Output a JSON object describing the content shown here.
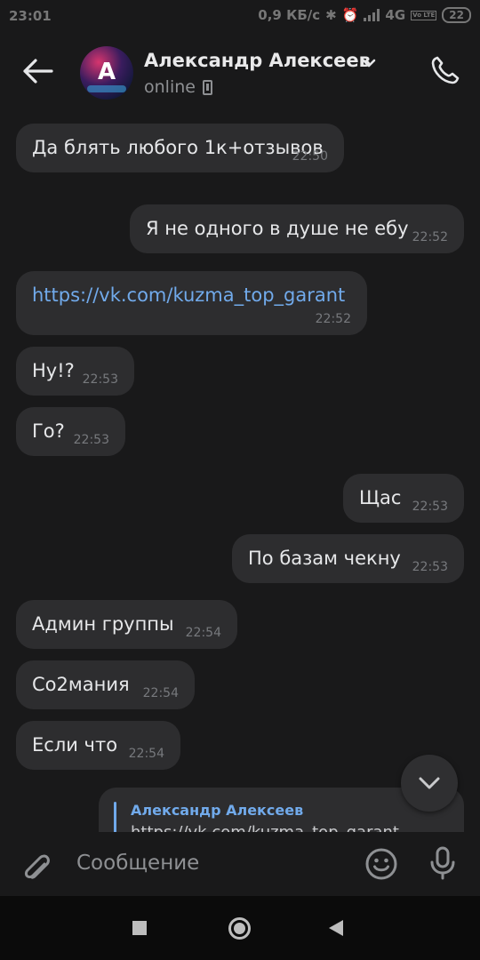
{
  "statusbar": {
    "time": "23:01",
    "speed": "0,9 КБ/с",
    "network": "4G",
    "network_sub": "Vo LTE",
    "battery": "22"
  },
  "header": {
    "name": "Александр Алексеев",
    "status": "online",
    "avatar_letter": "A"
  },
  "messages": [
    {
      "dir": "in",
      "text": "Да блять любого 1к+отзывов",
      "time": "22:50"
    },
    {
      "dir": "out",
      "text": "Я не одного в душе не ебу",
      "time": "22:52"
    },
    {
      "dir": "in",
      "text": "https://vk.com/kuzma_top_garant",
      "time": "22:52",
      "link": true
    },
    {
      "dir": "in",
      "text": "Ну!?",
      "time": "22:53"
    },
    {
      "dir": "in",
      "text": "Го?",
      "time": "22:53"
    },
    {
      "dir": "out",
      "text": "Щас",
      "time": "22:53"
    },
    {
      "dir": "out",
      "text": "По базам чекну",
      "time": "22:53"
    },
    {
      "dir": "in",
      "text": "Админ группы",
      "time": "22:54"
    },
    {
      "dir": "in",
      "text": "Со2мания",
      "time": "22:54"
    },
    {
      "dir": "in",
      "text": "Если что",
      "time": "22:54"
    }
  ],
  "reply": {
    "author": "Александр Алексеев",
    "text": "https://vk.com/kuzma_top_garant"
  },
  "composer": {
    "placeholder": "Сообщение"
  },
  "colors": {
    "background": "#19191a",
    "bubble": "#2d2d2f",
    "link": "#71aaeb",
    "time": "#77797d"
  }
}
